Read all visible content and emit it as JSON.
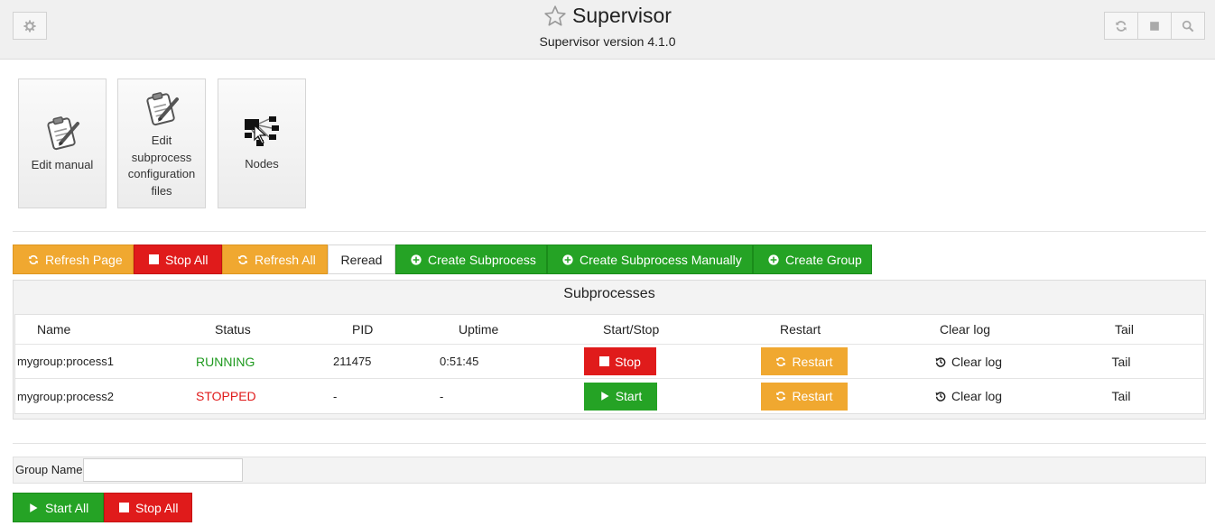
{
  "header": {
    "title": "Supervisor",
    "version": "Supervisor version 4.1.0",
    "left_button_icon": "gear-icon",
    "right_buttons": [
      "refresh-icon",
      "stop-icon",
      "search-icon"
    ]
  },
  "tiles": [
    {
      "label": "Edit manual",
      "icon": "clipboard-edit-icon"
    },
    {
      "label": "Edit subprocess configuration files",
      "icon": "clipboard-edit-icon"
    },
    {
      "label": "Nodes",
      "icon": "network-nodes-icon"
    }
  ],
  "toolbar": {
    "refresh_page": "Refresh Page",
    "stop_all": "Stop All",
    "refresh_all": "Refresh All",
    "reread": "Reread",
    "create_subprocess": "Create Subprocess",
    "create_subprocess_manually": "Create Subprocess Manually",
    "create_group": "Create Group"
  },
  "subprocesses": {
    "title": "Subprocesses",
    "columns": [
      "Name",
      "Status",
      "PID",
      "Uptime",
      "Start/Stop",
      "Restart",
      "Clear log",
      "Tail"
    ],
    "rows": [
      {
        "name": "mygroup:process1",
        "status": "RUNNING",
        "pid": "211475",
        "uptime": "0:51:45",
        "action": "Stop",
        "restart": "Restart",
        "clear_log": "Clear log",
        "tail": "Tail"
      },
      {
        "name": "mygroup:process2",
        "status": "STOPPED",
        "pid": "-",
        "uptime": "-",
        "action": "Start",
        "restart": "Restart",
        "clear_log": "Clear log",
        "tail": "Tail"
      }
    ]
  },
  "group": {
    "label": "Group Name",
    "value": "",
    "placeholder": ""
  },
  "bottom": {
    "start_all": "Start All",
    "stop_all": "Stop All"
  },
  "colors": {
    "orange": "#f0a830",
    "red": "#e01b1b",
    "green": "#25a325",
    "running": "#1f9a1f"
  }
}
